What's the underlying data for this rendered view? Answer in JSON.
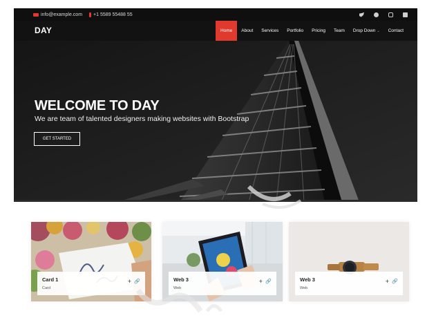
{
  "topbar": {
    "email": "info@example.com",
    "phone": "+1 5589 55488 55",
    "social": [
      "twitter-icon",
      "facebook-icon",
      "instagram-icon",
      "linkedin-icon"
    ]
  },
  "header": {
    "logo": "DAY",
    "nav": {
      "home": "Home",
      "about": "About",
      "services": "Services",
      "portfolio": "Portfolio",
      "pricing": "Pricing",
      "team": "Team",
      "dropdown": "Drop Down",
      "contact": "Contact"
    }
  },
  "hero": {
    "title": "WELCOME TO DAY",
    "subtitle": "We are team of talented designers making websites with Bootstrap",
    "button": "GET STARTED"
  },
  "portfolio": {
    "items": [
      {
        "name": "Card 1",
        "category": "Card"
      },
      {
        "name": "Web 3",
        "category": "Web"
      },
      {
        "name": "Web 3",
        "category": "Web"
      }
    ],
    "actions": {
      "plus": "+",
      "link": "🔗"
    }
  },
  "colors": {
    "accent": "#e03a2e",
    "topbar_bg": "#0f0f0f",
    "header_bg": "#121212",
    "hero_bg": "#1e1e1e"
  }
}
